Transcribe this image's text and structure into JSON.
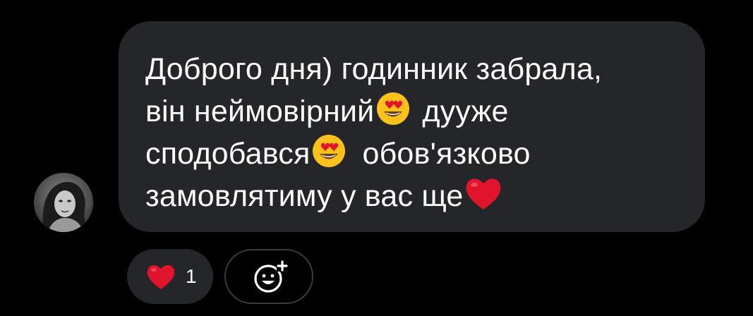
{
  "message": {
    "lines": [
      [
        "Доброго дня) годинник забрала,"
      ],
      [
        "він неймовірний",
        "дууже"
      ],
      [
        "сподобався",
        "обов'язково"
      ],
      [
        "замовлятиму у вас ще"
      ]
    ],
    "line1": "Доброго дня) годинник забрала,",
    "line2a": "він неймовірний",
    "line2b": "дууже",
    "line3a": "сподобався",
    "line3b": "обов'язково",
    "line4": "замовлятиму у вас ще",
    "emojis": [
      "heart-eyes-emoji",
      "heart-eyes-emoji",
      "red-heart-emoji"
    ]
  },
  "reactions": {
    "heart_count": "1",
    "heart_icon": "red-heart-icon",
    "add_icon": "add-emoji-reaction-icon"
  },
  "colors": {
    "background": "#000000",
    "bubble": "#25262a",
    "text": "#ffffff",
    "heart": "#e0142c",
    "emoji_face": "#fcc21b"
  }
}
